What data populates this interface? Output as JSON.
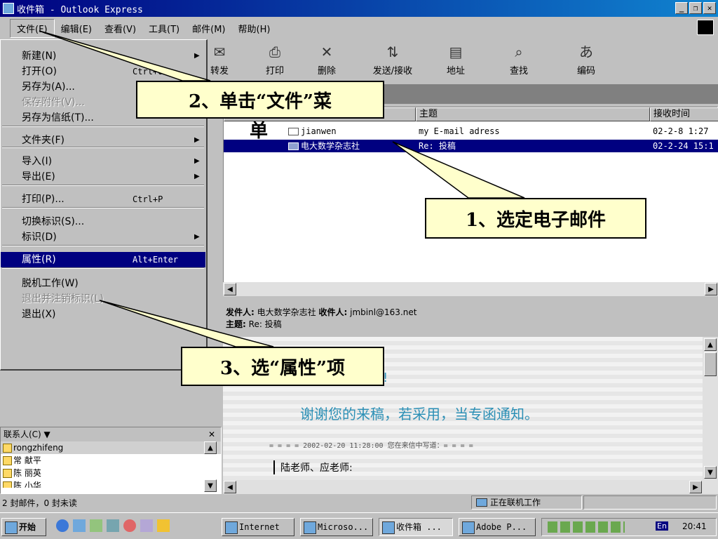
{
  "window": {
    "title": "收件箱 - Outlook Express"
  },
  "menubar": [
    "文件(F)",
    "编辑(E)",
    "查看(V)",
    "工具(T)",
    "邮件(M)",
    "帮助(H)"
  ],
  "toolbar": [
    "转发",
    "打印",
    "删除",
    "发送/接收",
    "地址",
    "查找",
    "编码"
  ],
  "file_menu": {
    "items": [
      {
        "label": "新建(N)",
        "shortcut": "",
        "submenu": true,
        "disabled": false
      },
      {
        "label": "打开(O)",
        "shortcut": "Ctrl+O",
        "submenu": false,
        "disabled": false
      },
      {
        "label": "另存为(A)...",
        "shortcut": "",
        "submenu": false,
        "disabled": false
      },
      {
        "label": "保存附件(V)...",
        "shortcut": "",
        "submenu": false,
        "disabled": true
      },
      {
        "label": "另存为信纸(T)...",
        "shortcut": "",
        "submenu": false,
        "disabled": false
      },
      {
        "label": "文件夹(F)",
        "shortcut": "",
        "submenu": true,
        "disabled": false
      },
      {
        "label": "导入(I)",
        "shortcut": "",
        "submenu": true,
        "disabled": false
      },
      {
        "label": "导出(E)",
        "shortcut": "",
        "submenu": true,
        "disabled": false
      },
      {
        "label": "打印(P)...",
        "shortcut": "Ctrl+P",
        "submenu": false,
        "disabled": false
      },
      {
        "label": "切换标识(S)...",
        "shortcut": "",
        "submenu": false,
        "disabled": false
      },
      {
        "label": "标识(D)",
        "shortcut": "",
        "submenu": true,
        "disabled": false
      },
      {
        "label": "属性(R)",
        "shortcut": "Alt+Enter",
        "submenu": false,
        "disabled": false,
        "selected": true
      },
      {
        "label": "脱机工作(W)",
        "shortcut": "",
        "submenu": false,
        "disabled": false
      },
      {
        "label": "退出并注销标识(L)",
        "shortcut": "",
        "submenu": false,
        "disabled": true
      },
      {
        "label": "退出(X)",
        "shortcut": "",
        "submenu": false,
        "disabled": false
      }
    ]
  },
  "message_list": {
    "columns": [
      "主题",
      "接收时间"
    ],
    "rows": [
      {
        "from": "jianwen",
        "subject": "my E-mail adress",
        "received": "02-2-8 1:27",
        "selected": false
      },
      {
        "from": "电大数学杂志社",
        "subject": "Re: 投稿",
        "received": "02-2-24 15:1",
        "selected": true
      }
    ]
  },
  "preview": {
    "from_label": "发件人:",
    "from": "电大数学杂志社",
    "to_label": "收件人:",
    "to": "jmbinl@163.net",
    "subject_label": "主题:",
    "subject": "Re: 投稿",
    "greeting": "谢谢您的来稿，若采用，当专函通知。",
    "quote_line": "= = = = 2002-02-20 11:28:00 您在来信中写道：= = = =",
    "body_line": "陆老师、应老师:",
    "exclaim": "!"
  },
  "contacts": {
    "header": "联系人(C) ▼",
    "items": [
      "rongzhifeng",
      "常 献平",
      "陈 丽英",
      "陈 小华"
    ]
  },
  "status": {
    "left": "2 封邮件，0 封未读",
    "right": "正在联机工作"
  },
  "taskbar": {
    "start": "开始",
    "tasks": [
      "Internet",
      "Microso...",
      "收件箱 ...",
      "Adobe P..."
    ],
    "clock": "20:41",
    "lang": "En"
  },
  "callouts": {
    "c1": "1、选定电子邮件",
    "c2": "2、单击“文件”菜",
    "c2b": "单",
    "c3": "3、选“属性”项"
  },
  "colors": {
    "selection": "#000080",
    "callout_fill": "#ffffcc",
    "title_start": "#000080",
    "title_end": "#1084d0"
  }
}
